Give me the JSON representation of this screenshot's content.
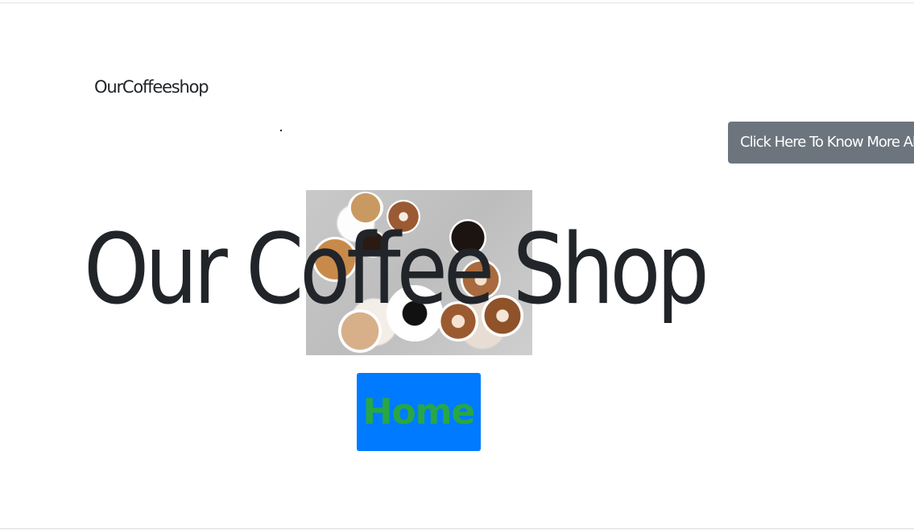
{
  "nav": {
    "brand": "OurCoffeeshop",
    "more_button_label": "Click Here To Know More About Us"
  },
  "hero": {
    "title": "Our Coffee Shop",
    "image_alt": "coffee-cups-top-view",
    "home_button_label": "Home"
  },
  "colors": {
    "text": "#212529",
    "secondary_button_bg": "#6c757d",
    "primary_button_bg": "#007bff",
    "home_text": "#28a745"
  }
}
